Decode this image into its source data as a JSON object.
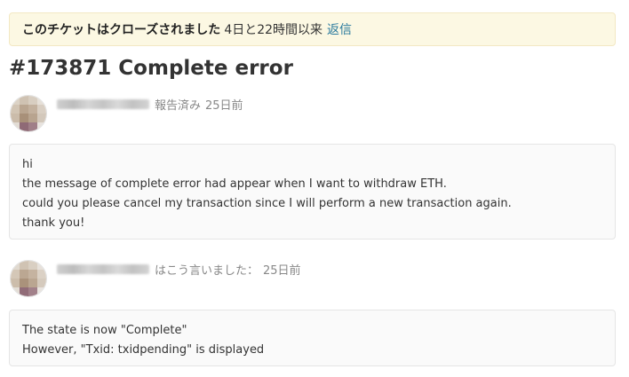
{
  "notice": {
    "status": "このチケットはクローズされました",
    "time_since": "4日と22時間以来",
    "reply_link": "返信"
  },
  "ticket": {
    "title": "#173871 Complete error"
  },
  "posts": [
    {
      "meta_action": "報告済み",
      "meta_time": "25日前",
      "lines": [
        "hi",
        "the message of complete error had appear when I want to withdraw ETH.",
        "could you please cancel my transaction since I will perform a new transaction again.",
        "thank you!"
      ]
    },
    {
      "meta_action": "はこう言いました：",
      "meta_time": "25日前",
      "lines": [
        "The state is now \"Complete\"",
        "However, \"Txid: txidpending\" is displayed"
      ]
    }
  ],
  "colors": {
    "notice_bg": "#fcf8e3",
    "link": "#2a7a9e",
    "meta_text": "#888888",
    "post_bg": "#fafafa"
  },
  "icons": {
    "avatar": "avatar-image"
  }
}
